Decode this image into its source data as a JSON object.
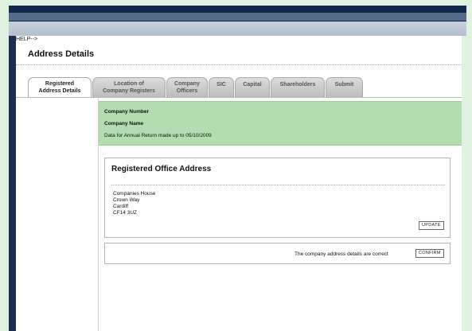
{
  "help": "HELP-->",
  "page_title": "Address Details",
  "tabs": [
    {
      "line1": "Registered",
      "line2": "Address Details",
      "active": true
    },
    {
      "line1": "Location of",
      "line2": "Company Registers",
      "active": false
    },
    {
      "line1": "Company",
      "line2": "Officers",
      "active": false
    },
    {
      "line1": "SIC",
      "line2": "",
      "active": false
    },
    {
      "line1": "Capital",
      "line2": "",
      "active": false
    },
    {
      "line1": "Shareholders",
      "line2": "",
      "active": false
    },
    {
      "line1": "Submit",
      "line2": "",
      "active": false
    }
  ],
  "info": {
    "company_number_label": "Company Number",
    "company_name_label": "Company Name",
    "annual_return_text": "Data for Annual Return made up to",
    "annual_return_date": "05/10/2009"
  },
  "registered_office": {
    "title": "Registered Office Address",
    "address": [
      "Companies House",
      "Crown Way",
      "Cardiff",
      "CF14 3UZ"
    ],
    "update_label": "UPDATE"
  },
  "confirm": {
    "text": "The company address details are correct",
    "button_label": "CONFIRM"
  }
}
